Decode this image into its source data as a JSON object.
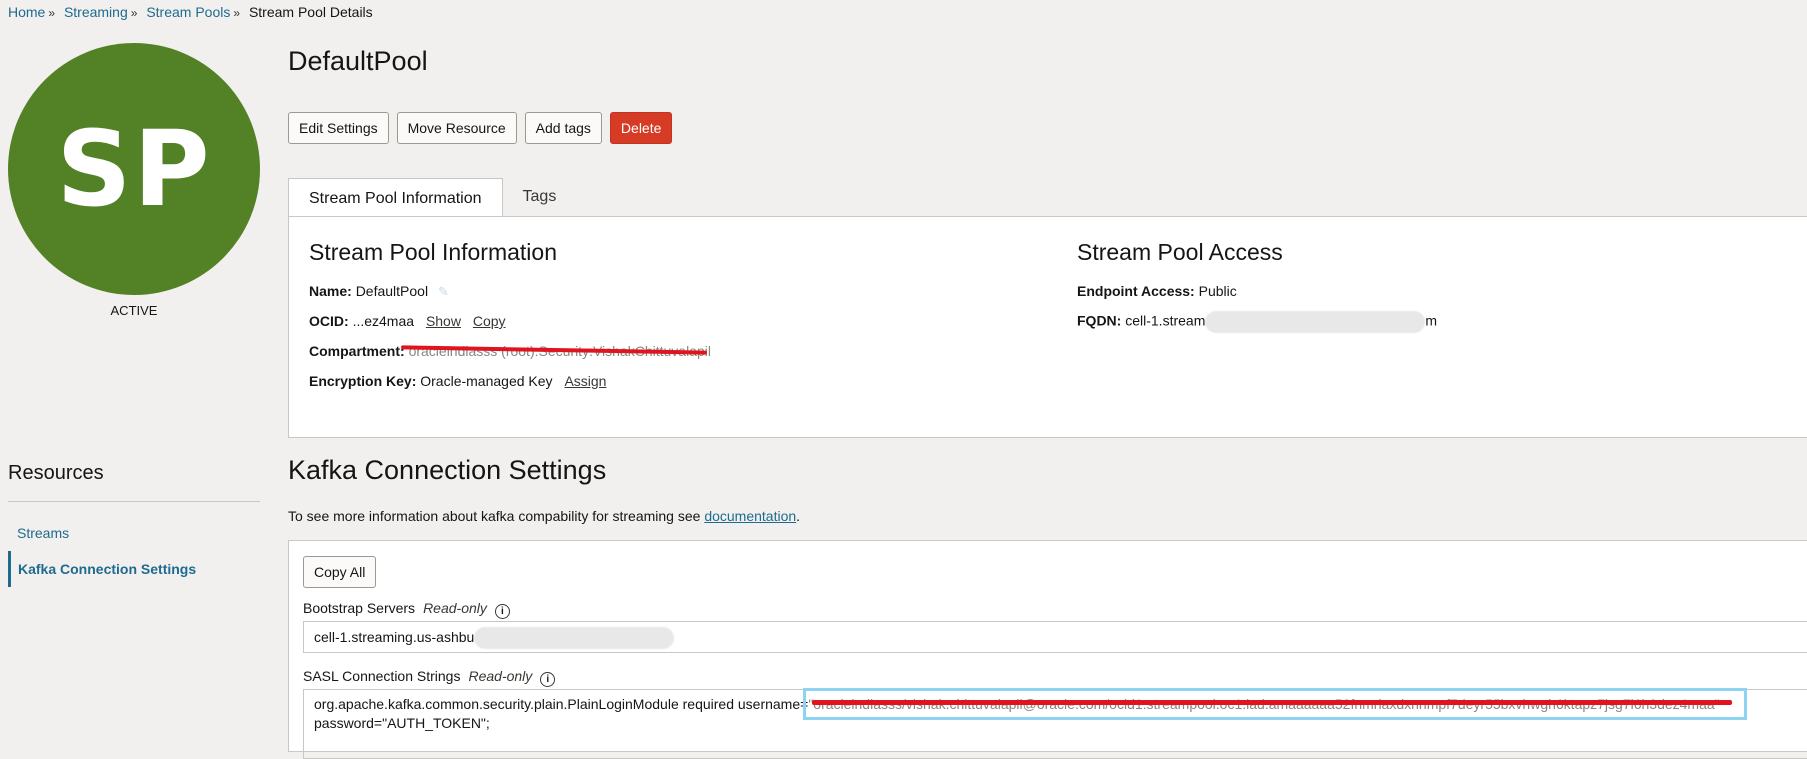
{
  "breadcrumb": {
    "items": [
      "Home",
      "Streaming",
      "Stream Pools"
    ],
    "current": "Stream Pool Details"
  },
  "avatar": {
    "initials": "SP",
    "status": "ACTIVE",
    "color": "#538125"
  },
  "resources": {
    "title": "Resources",
    "items": [
      "Streams",
      "Kafka Connection Settings"
    ]
  },
  "header": {
    "title": "DefaultPool",
    "buttons": {
      "edit": "Edit Settings",
      "move": "Move Resource",
      "tags": "Add tags",
      "delete": "Delete"
    }
  },
  "tabs": [
    "Stream Pool Information",
    "Tags"
  ],
  "info": {
    "title": "Stream Pool Information",
    "name_label": "Name:",
    "name_value": "DefaultPool",
    "ocid_label": "OCID:",
    "ocid_value": "...ez4maa",
    "ocid_show": "Show",
    "ocid_copy": "Copy",
    "compartment_label": "Compartment:",
    "compartment_value": "oracleindiasss (root):Security:VishakChittuvalapil",
    "encryption_label": "Encryption Key:",
    "encryption_value": "Oracle-managed Key",
    "encryption_assign": "Assign"
  },
  "access": {
    "title": "Stream Pool Access",
    "endpoint_label": "Endpoint Access:",
    "endpoint_value": "Public",
    "fqdn_label": "FQDN:",
    "fqdn_prefix": "cell-1.stream",
    "fqdn_suffix": "m"
  },
  "kafka": {
    "title": "Kafka Connection Settings",
    "desc": "To see more information about kafka compability for streaming see ",
    "desc_link": "documentation",
    "desc_end": ".",
    "copy_all": "Copy All",
    "bootstrap_label": "Bootstrap Servers",
    "readonly": "Read-only",
    "bootstrap_value": "cell-1.streaming.us-ashbu",
    "sasl_label": "SASL Connection Strings",
    "sasl_line1": "org.apache.kafka.common.security.plain.PlainLoginModule required username=",
    "sasl_username": "\"oracleindiasss/vishak.chittuvalapil@oracle.com/ocid1.streampool.oc1.iad.amaaaaaa52fnmrlaxdxnnmpf7deyr55bxvhwgh6ktapz7jsg7i6h3dez4maa\"",
    "sasl_line2": "password=\"AUTH_TOKEN\";"
  },
  "colors": {
    "accent": "#1e6b8f",
    "danger": "#d63b25",
    "redaction": "#e0141e",
    "highlight": "#8fd3f2"
  }
}
